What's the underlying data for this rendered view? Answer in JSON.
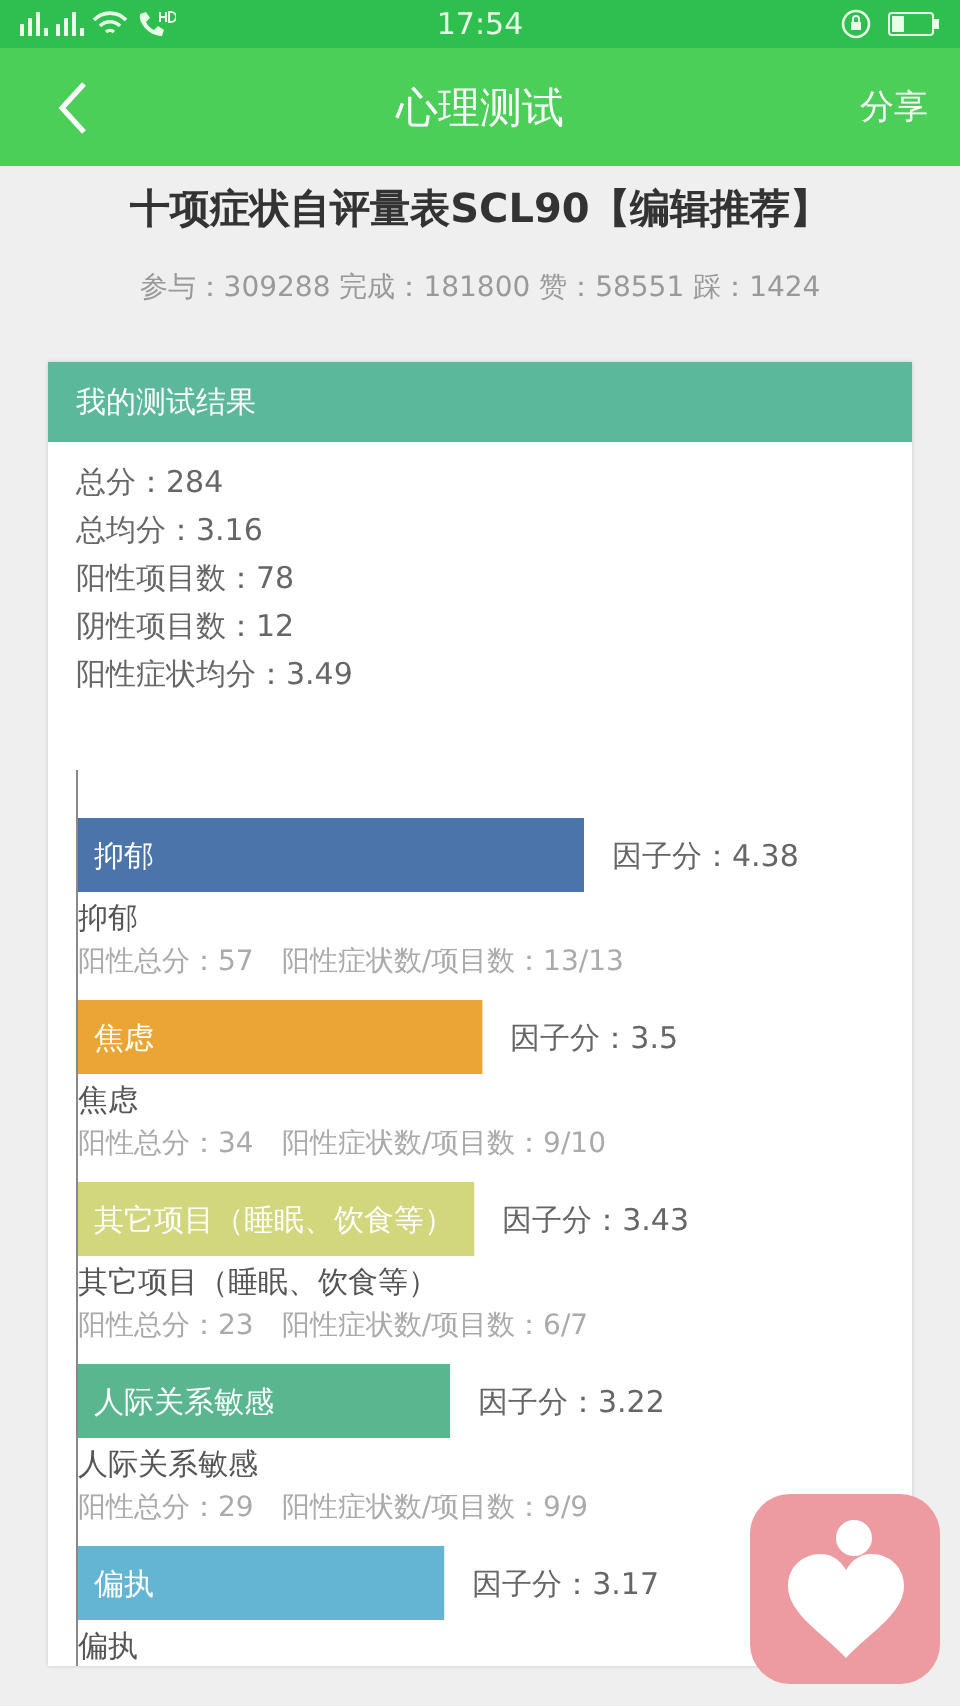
{
  "status_bar": {
    "time": "17:54"
  },
  "header": {
    "title": "心理测试",
    "action": "分享"
  },
  "test": {
    "title": "十项症状自评量表SCL90【编辑推荐】",
    "stats": "参与：309288 完成：181800 赞：58551 踩：1424"
  },
  "result": {
    "heading": "我的测试结果",
    "summary": [
      "总分：284",
      "总均分：3.16",
      "阳性项目数：78",
      "阴性项目数：12",
      "阳性症状均分：3.49"
    ],
    "chart_data": {
      "type": "bar",
      "orientation": "horizontal",
      "categories": [
        "抑郁",
        "焦虑",
        "其它项目（睡眠、饮食等）",
        "人际关系敏感",
        "偏执"
      ],
      "values": [
        4.38,
        3.5,
        3.43,
        3.22,
        3.17
      ],
      "data_labels": true,
      "value_labels": [
        "因子分：4.38",
        "因子分：3.5",
        "因子分：3.43",
        "因子分：3.22",
        "因子分：3.17"
      ]
    },
    "factors": [
      {
        "color": "#4a74aa",
        "name": "抑郁",
        "total": "阳性总分：57",
        "ratio": "阳性症状数/项目数：13/13"
      },
      {
        "color": "#eba534",
        "name": "焦虑",
        "total": "阳性总分：34",
        "ratio": "阳性症状数/项目数：9/10"
      },
      {
        "color": "#d2d67c",
        "name": "其它项目（睡眠、饮食等）",
        "total": "阳性总分：23",
        "ratio": "阳性症状数/项目数：6/7"
      },
      {
        "color": "#5ab68e",
        "name": "人际关系敏感",
        "total": "阳性总分：29",
        "ratio": "阳性症状数/项目数：9/9"
      },
      {
        "color": "#63b5d3",
        "name": "偏执"
      }
    ]
  }
}
